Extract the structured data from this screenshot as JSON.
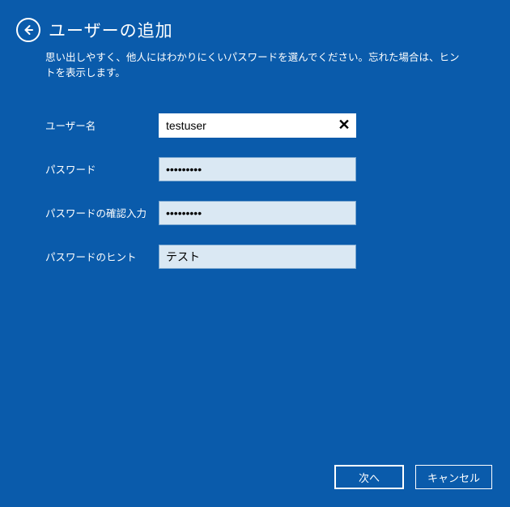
{
  "header": {
    "title": "ユーザーの追加"
  },
  "description": "思い出しやすく、他人にはわかりにくいパスワードを選んでください。忘れた場合は、ヒントを表示します。",
  "form": {
    "username": {
      "label": "ユーザー名",
      "value": "testuser"
    },
    "password": {
      "label": "パスワード",
      "value": "•••••••••"
    },
    "password_confirm": {
      "label": "パスワードの確認入力",
      "value": "•••••••••"
    },
    "hint": {
      "label": "パスワードのヒント",
      "value": "テスト"
    }
  },
  "buttons": {
    "next": "次へ",
    "cancel": "キャンセル"
  }
}
